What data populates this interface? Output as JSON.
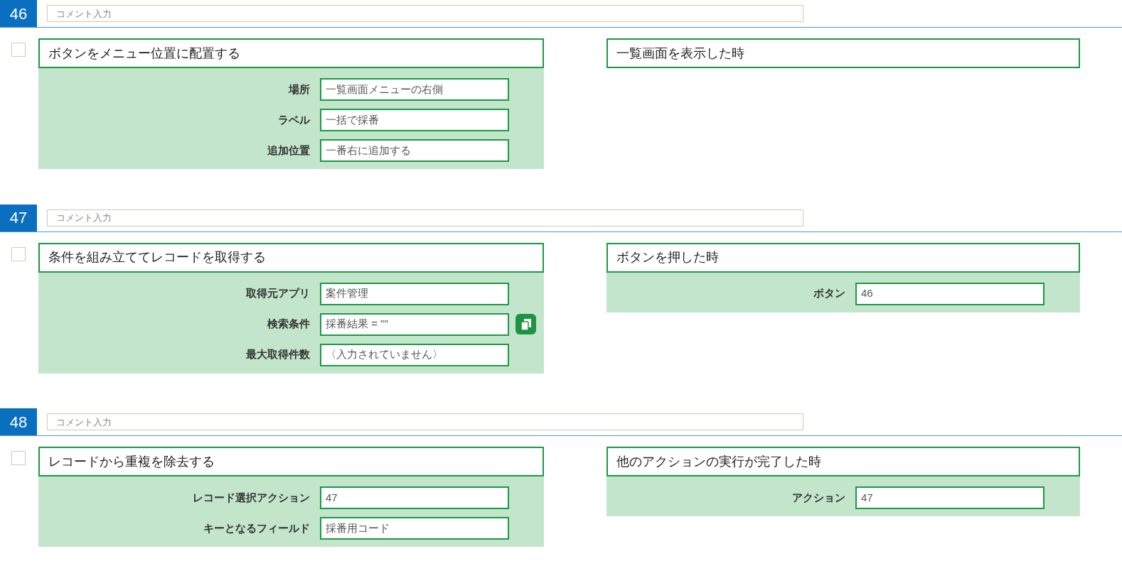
{
  "sections": [
    {
      "number": "46",
      "comment_placeholder": "コメント入力",
      "checked": false,
      "action": {
        "title": "ボタンをメニュー位置に配置する",
        "fields": [
          {
            "label": "場所",
            "value": "一覧画面メニューの右側",
            "copy_button": false
          },
          {
            "label": "ラベル",
            "value": "一括で採番",
            "copy_button": false
          },
          {
            "label": "追加位置",
            "value": "一番右に追加する",
            "copy_button": false
          }
        ]
      },
      "trigger": {
        "title": "一覧画面を表示した時"
      }
    },
    {
      "number": "47",
      "comment_placeholder": "コメント入力",
      "checked": false,
      "action": {
        "title": "条件を組み立ててレコードを取得する",
        "fields": [
          {
            "label": "取得元アプリ",
            "value": "案件管理",
            "copy_button": false
          },
          {
            "label": "検索条件",
            "value": "採番結果 = \"\"",
            "copy_button": true
          },
          {
            "label": "最大取得件数",
            "value": "〈入力されていません〉",
            "copy_button": false
          }
        ]
      },
      "trigger": {
        "title": "ボタンを押した時",
        "fields": [
          {
            "label": "ボタン",
            "value": "46"
          }
        ]
      }
    },
    {
      "number": "48",
      "comment_placeholder": "コメント入力",
      "checked": false,
      "action": {
        "title": "レコードから重複を除去する",
        "fields": [
          {
            "label": "レコード選択アクション",
            "value": "47",
            "copy_button": false
          },
          {
            "label": "キーとなるフィールド",
            "value": "採番用コード",
            "copy_button": false
          }
        ]
      },
      "trigger": {
        "title": "他のアクションの実行が完了した時",
        "fields": [
          {
            "label": "アクション",
            "value": "47"
          }
        ]
      }
    }
  ]
}
